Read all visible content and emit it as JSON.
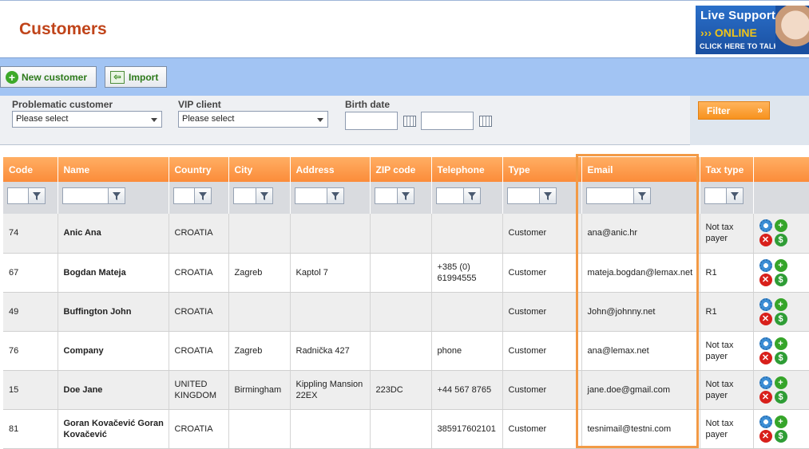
{
  "header": {
    "title": "Customers"
  },
  "support_banner": {
    "line1": "Live Support",
    "line2": "ONLINE",
    "line3": "CLICK HERE TO TALK!"
  },
  "toolbar": {
    "new_customer": "New customer",
    "import": "Import"
  },
  "filters": {
    "problematic_label": "Problematic customer",
    "problematic_value": "Please select",
    "vip_label": "VIP client",
    "vip_value": "Please select",
    "birth_label": "Birth date",
    "filter_button": "Filter"
  },
  "grid": {
    "columns": [
      "Code",
      "Name",
      "Country",
      "City",
      "Address",
      "ZIP code",
      "Telephone",
      "Type",
      "Email",
      "Tax type",
      ""
    ],
    "rows": [
      {
        "code": "74",
        "name": "Anic Ana",
        "country": "CROATIA",
        "city": "",
        "address": "",
        "zip": "",
        "phone": "",
        "type": "Customer",
        "email": "ana@anic.hr",
        "tax": "Not tax payer"
      },
      {
        "code": "67",
        "name": "Bogdan Mateja",
        "country": "CROATIA",
        "city": "Zagreb",
        "address": "Kaptol 7",
        "zip": "",
        "phone": "+385 (0) 61994555",
        "type": "Customer",
        "email": "mateja.bogdan@lemax.net",
        "tax": "R1"
      },
      {
        "code": "49",
        "name": "Buffington John",
        "country": "CROATIA",
        "city": "",
        "address": "",
        "zip": "",
        "phone": "",
        "type": "Customer",
        "email": "John@johnny.net",
        "tax": "R1"
      },
      {
        "code": "76",
        "name": "Company",
        "country": "CROATIA",
        "city": "Zagreb",
        "address": "Radnička 427",
        "zip": "",
        "phone": "phone",
        "type": "Customer",
        "email": "ana@lemax.net",
        "tax": "Not tax payer"
      },
      {
        "code": "15",
        "name": "Doe Jane",
        "country": "UNITED KINGDOM",
        "city": "Birmingham",
        "address": "Kippling Mansion 22EX",
        "zip": "223DC",
        "phone": "+44 567 8765",
        "type": "Customer",
        "email": "jane.doe@gmail.com",
        "tax": "Not tax payer"
      },
      {
        "code": "81",
        "name": "Goran Kovačević Goran Kovačević",
        "country": "CROATIA",
        "city": "",
        "address": "",
        "zip": "",
        "phone": "385917602101",
        "type": "Customer",
        "email": "tesnimail@testni.com",
        "tax": "Not tax payer"
      }
    ]
  },
  "colors": {
    "title": "#c0441a",
    "header_orange": "#fb8c3a",
    "toolbar_blue": "#a2c4f3",
    "highlight": "#f29a46"
  }
}
